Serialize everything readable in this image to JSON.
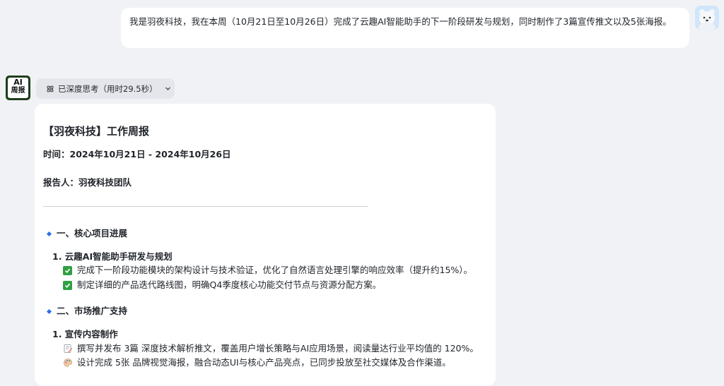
{
  "user_message": {
    "text": "我是羽夜科技，我在本周（10月21日至10月26日）完成了云趣AI智能助手的下一阶段研发与规划，同时制作了3篇宣传推文以及5张海报。"
  },
  "bot": {
    "avatar_line1": "AI",
    "avatar_line2": "周报"
  },
  "thinking": {
    "label": "已深度思考（用时29.5秒）",
    "icon": "atom-icon",
    "toggle_icon": "chevron-down-icon"
  },
  "report": {
    "title": "【羽夜科技】工作周报",
    "time": "时间：2024年10月21日 - 2024年10月26日",
    "reporter": "报告人：羽夜科技团队",
    "sections": [
      {
        "heading": "一、核心项目进展",
        "item": "1. 云趣AI智能助手研发与规划",
        "bullets": [
          "完成下一阶段功能模块的架构设计与技术验证，优化了自然语言处理引擎的响应效率（提升约15%）。",
          "制定详细的产品迭代路线图，明确Q4季度核心功能交付节点与资源分配方案。"
        ]
      },
      {
        "heading": "二、市场推广支持",
        "item": "1. 宣传内容制作",
        "bullets": [
          "撰写并发布 3篇 深度技术解析推文，覆盖用户增长策略与AI应用场景，阅读量达行业平均值的 120%。",
          "设计完成 5张 品牌视觉海报，融合动态UI与核心产品亮点，已同步投放至社交媒体及合作渠道。"
        ]
      }
    ]
  },
  "colors": {
    "page_bg": "#f1f2f5",
    "card_bg": "#ffffff",
    "chip_bg": "#e4e6eb",
    "accent": "#2f6fe8",
    "check": "#2ea043"
  }
}
